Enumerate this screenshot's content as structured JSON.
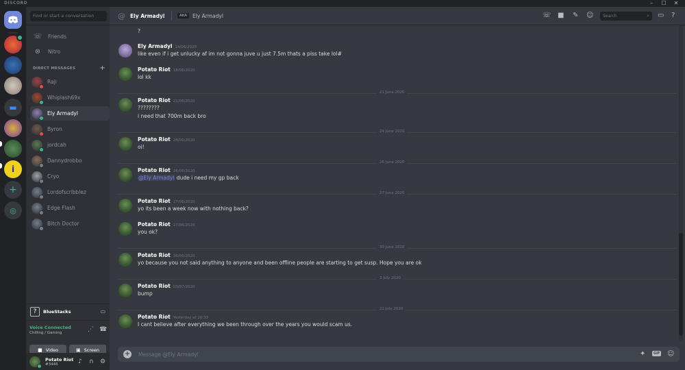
{
  "app": {
    "brand": "DISCORD",
    "window_controls": [
      "–",
      "☐",
      "✕"
    ]
  },
  "colors": {
    "blurple": "#7289da",
    "online": "#43b581",
    "dnd": "#f04747",
    "offline": "#747f8d"
  },
  "sidebar": {
    "search_placeholder": "Find or start a conversation",
    "nav": [
      {
        "label": "Friends",
        "icon": "friends-icon"
      },
      {
        "label": "Nitro",
        "icon": "nitro-icon"
      }
    ],
    "dm_header": "DIRECT MESSAGES",
    "dms": [
      {
        "name": "Raji",
        "status": "dnd",
        "color": "#9b4444"
      },
      {
        "name": "Whiplash69x",
        "status": "online",
        "color": "#a0462e"
      },
      {
        "name": "Ely Armadyl",
        "status": "online",
        "color": "#8d7fb4",
        "active": true
      },
      {
        "name": "Byron",
        "status": "dnd",
        "color": "#6d5a4a"
      },
      {
        "name": "jordcah",
        "status": "online",
        "color": "#5a7a55"
      },
      {
        "name": "Dannydrobbo",
        "status": "off",
        "color": "#8a6d5a"
      },
      {
        "name": "Cryo",
        "status": "off",
        "color": "#9ea4ad"
      },
      {
        "name": "Lordofscribblez",
        "status": "off",
        "color": "#747f8d"
      },
      {
        "name": "Edge Flash",
        "status": "off",
        "color": "#747f8d"
      },
      {
        "name": "Bitch Doctor",
        "status": "off",
        "color": "#747f8d"
      }
    ],
    "activity": {
      "title": "BlueStacks"
    },
    "voice": {
      "status": "Voice Connected",
      "channel": "Chilling / Gaming",
      "video_label": "Video",
      "screen_label": "Screen"
    },
    "user": {
      "name": "Potato Riot",
      "tag": "#3446"
    }
  },
  "header": {
    "name": "Ely Armadyl",
    "aka_label": "AKA",
    "nickname": "Ely Armadyl",
    "search_placeholder": "Search"
  },
  "messages": [
    {
      "kind": "line",
      "text": "?"
    },
    {
      "kind": "msg",
      "author": "Ely Armadyl",
      "time": "14/06/2020",
      "av": "ely",
      "lines": [
        "like even if i get unlucky af im not gonna juve u just 7.5m thats a piss take lol#"
      ]
    },
    {
      "kind": "msg",
      "author": "Potato Riot",
      "time": "18/06/2020",
      "av": "potato",
      "lines": [
        "lol kk"
      ]
    },
    {
      "kind": "divider",
      "label": "21 June 2020"
    },
    {
      "kind": "msg",
      "author": "Potato Riot",
      "time": "21/06/2020",
      "av": "potato",
      "lines": [
        "????????",
        "i need that 700m back bro"
      ]
    },
    {
      "kind": "divider",
      "label": "24 June 2020"
    },
    {
      "kind": "msg",
      "author": "Potato Riot",
      "time": "24/06/2020",
      "av": "potato",
      "lines": [
        "oi!"
      ]
    },
    {
      "kind": "divider",
      "label": "26 June 2020"
    },
    {
      "kind": "msg",
      "author": "Potato Riot",
      "time": "26/06/2020",
      "av": "potato",
      "mention": "@Ely Armadyl",
      "lines": [
        " dude i need my gp back"
      ]
    },
    {
      "kind": "divider",
      "label": "27 June 2020"
    },
    {
      "kind": "msg",
      "author": "Potato Riot",
      "time": "27/06/2020",
      "av": "potato",
      "lines": [
        "yo its been a week now with nothing back?"
      ]
    },
    {
      "kind": "msg",
      "author": "Potato Riot",
      "time": "27/06/2020",
      "av": "potato",
      "lines": [
        "you ok?"
      ]
    },
    {
      "kind": "divider",
      "label": "30 June 2020"
    },
    {
      "kind": "msg",
      "author": "Potato Riot",
      "time": "30/06/2020",
      "av": "potato",
      "lines": [
        "yo because you not said  anything to anyone and been offline people are starting to get susp. Hope you are ok"
      ]
    },
    {
      "kind": "divider",
      "label": "3 July 2020"
    },
    {
      "kind": "msg",
      "author": "Potato Riot",
      "time": "03/07/2020",
      "av": "potato",
      "lines": [
        "bump"
      ]
    },
    {
      "kind": "divider",
      "label": "22 July 2020"
    },
    {
      "kind": "msg",
      "author": "Potato Riot",
      "time": "Yesterday at 20:33",
      "av": "potato",
      "lines": [
        "I cant believe after everything we been through over the years you would scam us."
      ]
    }
  ],
  "composer": {
    "placeholder": "Message @Ely Armadyl",
    "gif_label": "GIF"
  }
}
